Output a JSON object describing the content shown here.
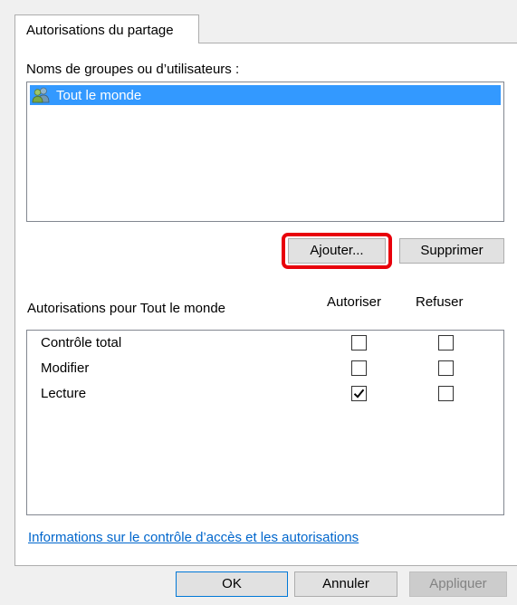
{
  "tab": {
    "label": "Autorisations du partage"
  },
  "users": {
    "label": "Noms de groupes ou d’utilisateurs :",
    "items": [
      {
        "name": "Tout le monde",
        "icon": "users-group-icon",
        "selected": true
      }
    ]
  },
  "buttons": {
    "add": "Ajouter...",
    "remove": "Supprimer"
  },
  "permissions": {
    "header_label": "Autorisations pour Tout le monde",
    "allow_header": "Autoriser",
    "deny_header": "Refuser",
    "rows": [
      {
        "name": "Contrôle total",
        "allow": false,
        "deny": false
      },
      {
        "name": "Modifier",
        "allow": false,
        "deny": false
      },
      {
        "name": "Lecture",
        "allow": true,
        "deny": false
      }
    ]
  },
  "link": {
    "text": "Informations sur le contrôle d’accès et les autorisations"
  },
  "footer": {
    "ok": "OK",
    "cancel": "Annuler",
    "apply": "Appliquer"
  },
  "colors": {
    "selection": "#3399ff",
    "highlight": "#e8000b",
    "link": "#0066cc",
    "default_button_border": "#0078d7"
  }
}
